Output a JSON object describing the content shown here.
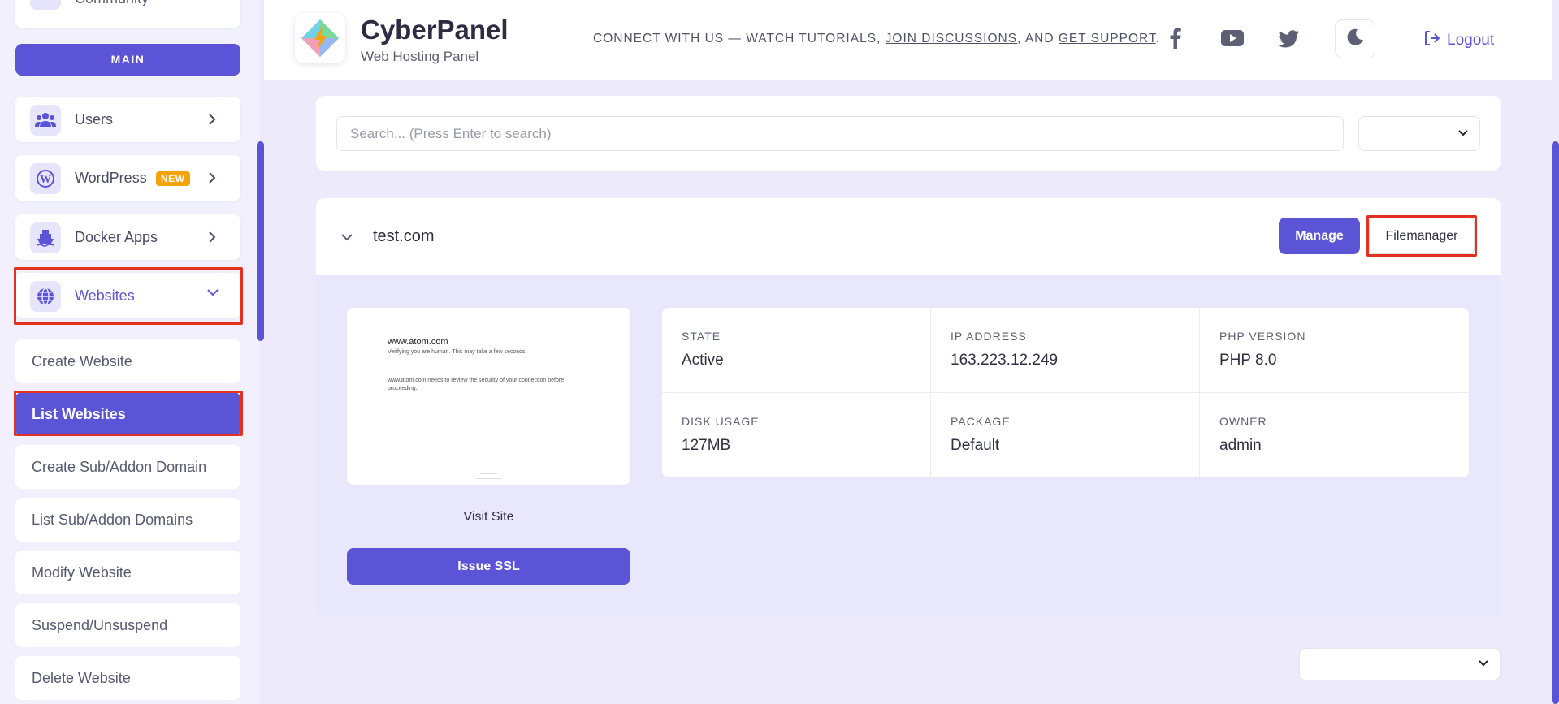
{
  "sidebar": {
    "community_label": "Community",
    "section_label": "MAIN",
    "items": [
      {
        "label": "Users",
        "icon": "users-icon"
      },
      {
        "label": "WordPress",
        "icon": "wordpress-icon",
        "badge": "NEW"
      },
      {
        "label": "Docker Apps",
        "icon": "docker-ship-icon"
      },
      {
        "label": "Websites",
        "icon": "globe-icon"
      }
    ],
    "subitems": [
      "Create Website",
      "List Websites",
      "Create Sub/Addon Domain",
      "List Sub/Addon Domains",
      "Modify Website",
      "Suspend/Unsuspend",
      "Delete Website"
    ]
  },
  "header": {
    "brand": "CyberPanel",
    "brand_sub": "Web Hosting Panel",
    "connect_prefix": "CONNECT WITH US — WATCH TUTORIALS, ",
    "join_link": "JOIN DISCUSSIONS",
    "connect_mid": ", AND ",
    "support_link": "GET SUPPORT",
    "connect_suffix": ".",
    "logout_label": "Logout"
  },
  "search": {
    "placeholder": "Search... (Press Enter to search)",
    "value": ""
  },
  "website": {
    "domain": "test.com",
    "manage_label": "Manage",
    "filemanager_label": "Filemanager",
    "preview": {
      "title": "www.atom.com",
      "line1": "Verifying you are human. This may take a few seconds.",
      "line2": "www.atom.com needs to review the security of your connection before",
      "line3": "proceeding."
    },
    "visit_site_label": "Visit Site",
    "issue_ssl_label": "Issue SSL",
    "details": [
      {
        "key": "STATE",
        "value": "Active"
      },
      {
        "key": "IP ADDRESS",
        "value": "163.223.12.249"
      },
      {
        "key": "PHP VERSION",
        "value": "PHP 8.0"
      },
      {
        "key": "DISK USAGE",
        "value": "127MB"
      },
      {
        "key": "PACKAGE",
        "value": "Default"
      },
      {
        "key": "OWNER",
        "value": "admin"
      }
    ]
  },
  "colors": {
    "accent": "#5b54d6",
    "highlight": "#e0321f",
    "badge": "#f5a30a",
    "background": "#eceafb"
  }
}
